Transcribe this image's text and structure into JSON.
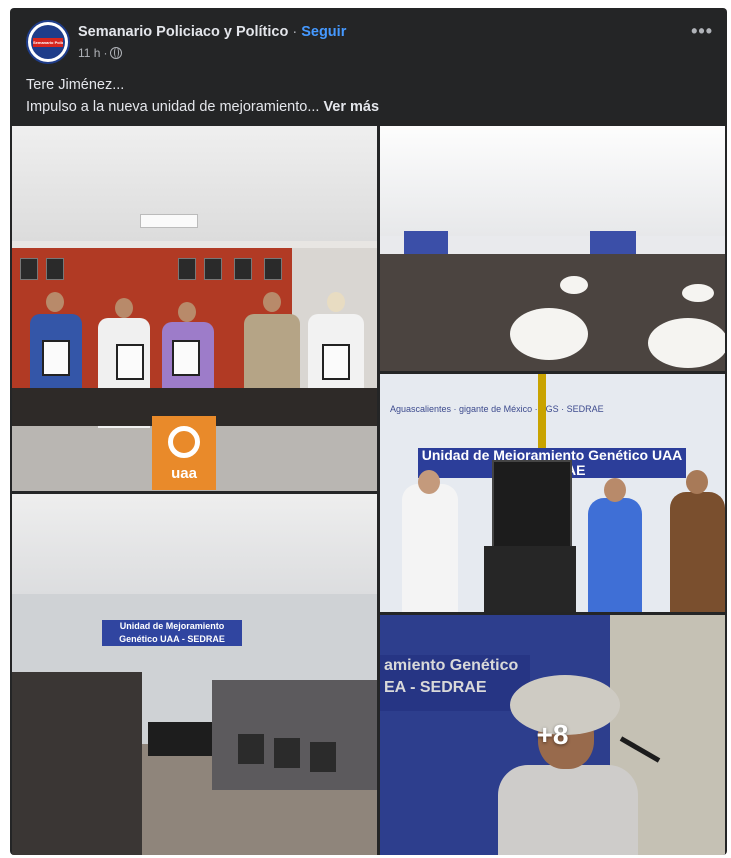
{
  "post": {
    "page_name": "Semanario Policiaco y Político",
    "separator": " · ",
    "follow_label": "Seguir",
    "time": "11 h",
    "meta_sep": "·",
    "privacy_icon": "globe-icon",
    "more_icon": "more-options-icon",
    "caption_line1": "Tere Jiménez...",
    "caption_line2": "Impulso a la nueva unidad de mejoramiento...",
    "see_more_label": "Ver más",
    "avatar_text": "Semanario Policiaco",
    "colors": {
      "background": "#242526",
      "text": "#e4e6eb",
      "secondary_text": "#b0b3b8",
      "link": "#4599ff"
    }
  },
  "photos": {
    "p1": {
      "sign_text": "uaa"
    },
    "p3": {
      "banner_text": "Unidad de Mejoramiento Genético UAA - SEDRAE",
      "logos_text": "Aguascalientes · gigante de México · AGS · SEDRAE"
    },
    "p4": {
      "banner_text": "Unidad de Mejoramiento Genético UAA - SEDRAE"
    },
    "p5": {
      "banner_text": "amiento Genético EA - SEDRAE",
      "more_count": "+8"
    }
  }
}
